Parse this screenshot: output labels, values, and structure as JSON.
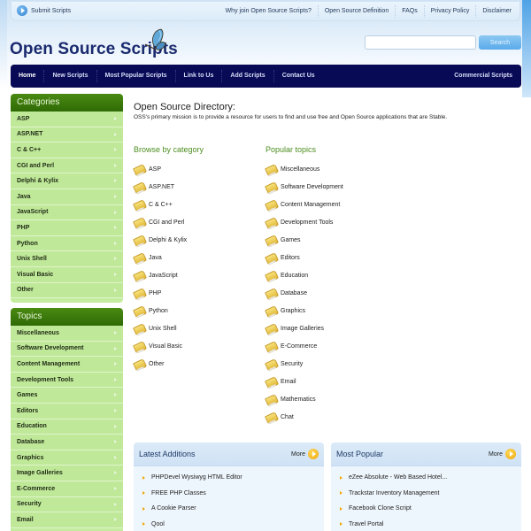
{
  "header": {
    "submit_label": "Submit Scripts",
    "top_links": [
      "Why join Open Source Scripts?",
      "Open Source Definition",
      "FAQs",
      "Privacy Policy",
      "Disclaimer"
    ],
    "logo_text": "Open Source Scripts",
    "search": {
      "value": "",
      "placeholder": "",
      "button_label": "Search"
    }
  },
  "nav": {
    "items": [
      "Home",
      "New Scripts",
      "Most Popular Scripts",
      "Link to Us",
      "Add Scripts",
      "Contact Us"
    ],
    "right_item": "Commercial Scripts"
  },
  "sidebar": {
    "categories": {
      "title": "Categories",
      "items": [
        "ASP",
        "ASP.NET",
        "C & C++",
        "CGI and Perl",
        "Delphi & Kylix",
        "Java",
        "JavaScript",
        "PHP",
        "Python",
        "Unix Shell",
        "Visual Basic",
        "Other"
      ]
    },
    "topics": {
      "title": "Topics",
      "items": [
        "Miscellaneous",
        "Software Development",
        "Content Management",
        "Development Tools",
        "Games",
        "Editors",
        "Education",
        "Database",
        "Graphics",
        "Image Galleries",
        "E-Commerce",
        "Security",
        "Email"
      ]
    }
  },
  "main": {
    "title": "Open Source Directory:",
    "description": "OSS's primary mission is to provide a resource for users to find and use free and Open Source applications that are Stable.",
    "browse": {
      "title": "Browse by category",
      "items": [
        "ASP",
        "ASP.NET",
        "C & C++",
        "CGI and Perl",
        "Delphi & Kylix",
        "Java",
        "JavaScript",
        "PHP",
        "Python",
        "Unix Shell",
        "Visual Basic",
        "Other"
      ]
    },
    "popular": {
      "title": "Popular topics",
      "items": [
        "Miscellaneous",
        "Software Development",
        "Content Management",
        "Development Tools",
        "Games",
        "Editors",
        "Education",
        "Database",
        "Graphics",
        "Image Galleries",
        "E-Commerce",
        "Security",
        "Email",
        "Mathematics",
        "Chat"
      ]
    }
  },
  "panels": {
    "latest": {
      "title": "Latest Additions",
      "more_label": "More",
      "items": [
        "PHPDevel Wysiwyg HTML Editor",
        "FREE PHP Classes",
        "A Cookie Parser",
        "Qool"
      ]
    },
    "popular": {
      "title": "Most Popular",
      "more_label": "More",
      "items": [
        "eZee Absolute - Web Based Hotel...",
        "Trackstar Inventory Management",
        "Facebook Clone Script",
        "Travel Portal"
      ]
    }
  },
  "colors": {
    "nav_bg": "#080a56",
    "logo": "#1a2a6e",
    "sidebar_head": "#2f6a06",
    "sidebar_item_bg": "#bfe899",
    "section_title": "#4c8d1f",
    "more_accent": "#efa80a"
  }
}
